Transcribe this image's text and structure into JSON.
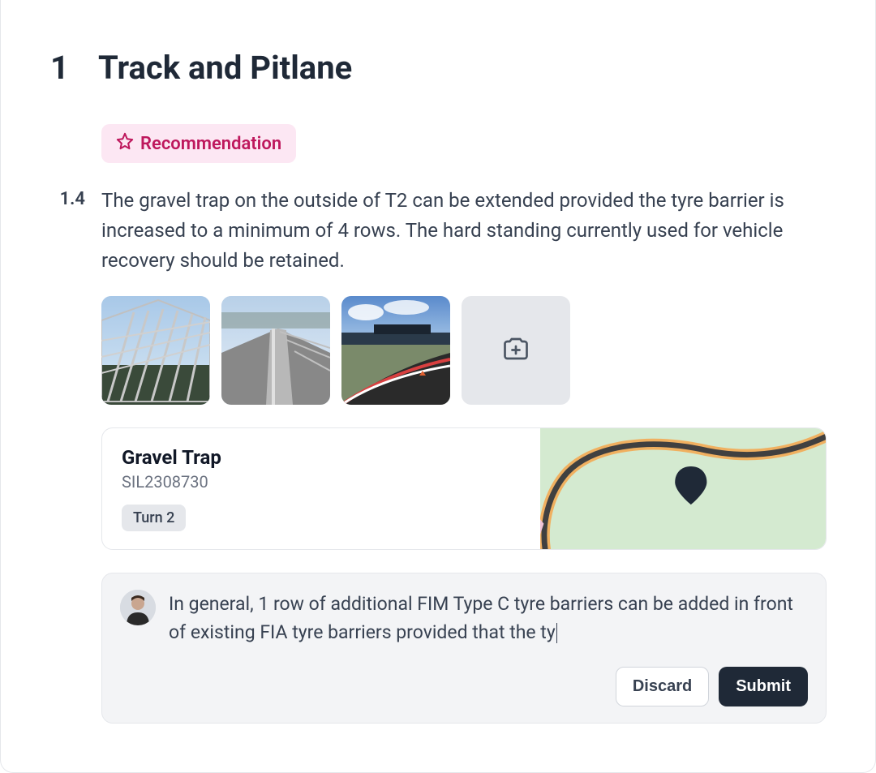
{
  "section": {
    "number": "1",
    "title": "Track and Pitlane"
  },
  "badge": {
    "label": "Recommendation"
  },
  "item": {
    "number": "1.4",
    "text": "The gravel trap on the outside of T2 can be extended provided the tyre barrier is increased to a minimum of 4 rows. The hard standing currently used for vehicle recovery should be retained."
  },
  "location": {
    "title": "Gravel Trap",
    "code": "SIL2308730",
    "tag": "Turn 2"
  },
  "comment": {
    "text": "In general, 1 row of additional FIM Type C tyre barriers can be added in front of existing FIA tyre barriers provided that the ty"
  },
  "actions": {
    "discard": "Discard",
    "submit": "Submit"
  }
}
